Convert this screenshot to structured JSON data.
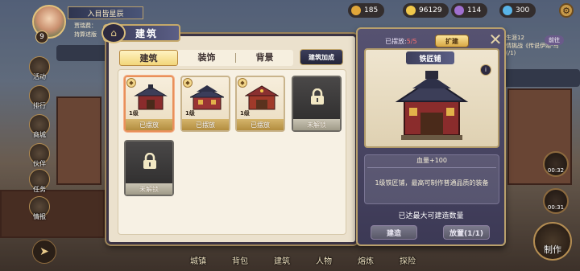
{
  "player": {
    "name": "入目皆星辰",
    "level": "9",
    "sub_line_1": "贾瑞费：",
    "sub_line_2": "持算述版"
  },
  "resources": [
    {
      "icon": "coin-icon",
      "value": "185",
      "color": "#e0a63a"
    },
    {
      "icon": "gold-icon",
      "value": "96129",
      "color": "#f1c84b"
    },
    {
      "icon": "gem-icon",
      "value": "114",
      "color": "#a070d0"
    },
    {
      "icon": "diamond-icon",
      "value": "300",
      "color": "#58b4e8"
    }
  ],
  "right_info": {
    "line1": "生涯12",
    "line2": "情挑战《传说伊始-鸟",
    "line3": "(/1)",
    "button": "前往"
  },
  "side_menu": [
    {
      "id": "activity",
      "label": "活动"
    },
    {
      "id": "ranking",
      "label": "排行"
    },
    {
      "id": "mail",
      "label": "商城"
    },
    {
      "id": "partner",
      "label": "伙伴"
    },
    {
      "id": "task",
      "label": "任务"
    },
    {
      "id": "intel",
      "label": "情报"
    }
  ],
  "timers": [
    {
      "value": "00:32"
    },
    {
      "value": "00:31"
    }
  ],
  "craft_label": "制作",
  "bottom_nav": [
    {
      "label": "城镇"
    },
    {
      "label": "背包"
    },
    {
      "label": "建筑"
    },
    {
      "label": "人物"
    },
    {
      "label": "熔炼"
    },
    {
      "label": "探险"
    }
  ],
  "panel": {
    "title": "建筑",
    "tabs": [
      {
        "label": "建筑",
        "active": true
      },
      {
        "label": "装饰",
        "active": false
      },
      {
        "label": "背景",
        "active": false
      }
    ],
    "bonus_button": "建筑加成",
    "cards": [
      {
        "level": "1级",
        "status": "已摆放",
        "locked": false,
        "selected": true
      },
      {
        "level": "1级",
        "status": "已摆放",
        "locked": false,
        "selected": false
      },
      {
        "level": "1级",
        "status": "已摆放",
        "locked": false,
        "selected": false
      },
      {
        "level": "",
        "status": "未解锁",
        "locked": true,
        "selected": false
      },
      {
        "level": "",
        "status": "未解锁",
        "locked": true,
        "selected": false
      }
    ]
  },
  "detail": {
    "placed_label": "已摆放:",
    "placed_count": "5/5",
    "expand_button": "扩建",
    "name": "铁匠铺",
    "stat": "血量+100",
    "description": "1级铁匠铺，最高可制作普通品质的装备",
    "max_note": "已达最大可建造数量",
    "build_button": "建造",
    "place_button": "放置(1/1)"
  }
}
